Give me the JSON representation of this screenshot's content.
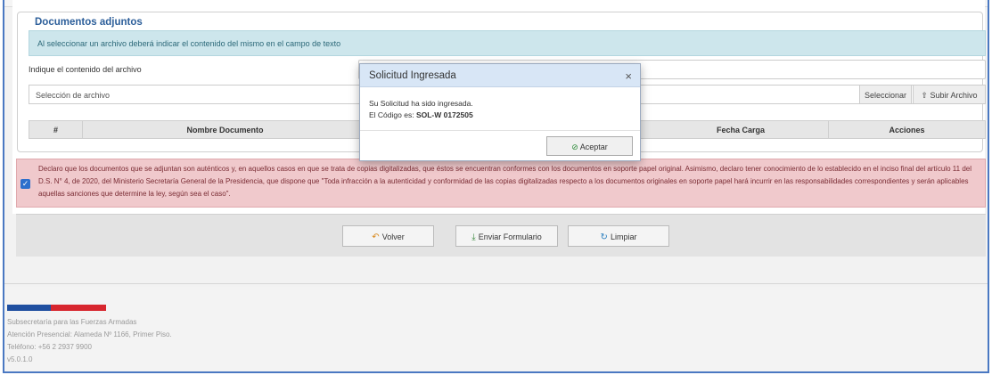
{
  "documents": {
    "legend": "Documentos adjuntos",
    "info_text": "Al seleccionar un archivo deberá indicar el contenido del mismo en el campo de texto",
    "content_label": "Indique el contenido del archivo",
    "content_value": "",
    "file_placeholder": "Selección de archivo",
    "select_label": "Seleccionar",
    "upload_label": "Subir Archivo",
    "table_columns": [
      "#",
      "Nombre Documento",
      "Fecha Carga",
      "Acciones"
    ]
  },
  "declaration": {
    "checked": true,
    "text": "Declaro que los documentos que se adjuntan son auténticos y, en aquellos casos en que se trata de copias digitalizadas, que éstos se encuentran conformes con los documentos en soporte papel original. Asimismo, declaro tener conocimiento de lo establecido en el inciso final del artículo 11 del D.S. N° 4, de 2020, del Ministerio Secretaría General de la Presidencia, que dispone que \"Toda infracción a la autenticidad y conformidad de las copias digitalizadas respecto a los documentos originales en soporte papel hará incurrir en las responsabilidades correspondientes y serán aplicables aquellas sanciones que determine la ley, según sea el caso\"."
  },
  "actions": {
    "back_label": "Volver",
    "send_label": "Enviar Formulario",
    "clear_label": "Limpiar"
  },
  "footer": {
    "line1": "Subsecretaría para las Fuerzas Armadas",
    "line2": "Atención Presencial: Alameda Nº 1166, Primer Piso.",
    "line3": "Teléfono: +56 2 2937 9900",
    "version": "v5.0.1.0"
  },
  "modal": {
    "title": "Solicitud Ingresada",
    "close": "×",
    "message": "Su Solicitud ha sido ingresada.",
    "code_label": "El Código es:",
    "code_value": "SOL-W 0172505",
    "accept_label": "Aceptar"
  },
  "colors": {
    "accent": "#2d5f9a",
    "info_bg": "#cde6ec",
    "declaration_bg": "#f0c9cc",
    "flag_blue": "#1f4fa0",
    "flag_red": "#d7262e"
  }
}
